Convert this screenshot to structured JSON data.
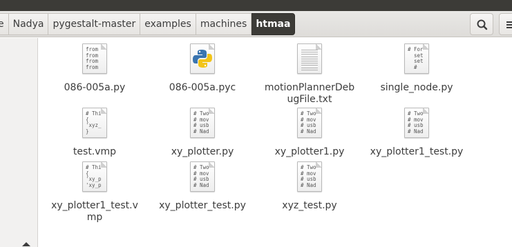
{
  "breadcrumb": {
    "items": [
      "e",
      "Nadya",
      "pygestalt-master",
      "examples",
      "machines"
    ],
    "current": "htmaa"
  },
  "header": {
    "search_icon": "search-icon",
    "menu_icon": "hamburger-menu-icon"
  },
  "sidebar": {
    "eject_icon": "eject-icon"
  },
  "files": [
    {
      "name": "086-005a.py",
      "kind": "text",
      "snippet": "from\nfrom\nfrom\nfrom"
    },
    {
      "name": "086-005a.pyc",
      "kind": "python"
    },
    {
      "name": "motionPlannerDebugFile.txt",
      "kind": "lines"
    },
    {
      "name": "single_node.py",
      "kind": "text",
      "snippet": "# For\n  set\n  set\n  #"
    },
    {
      "name": "test.vmp",
      "kind": "text",
      "snippet": "# Thi\n{\n'xyz_\n}"
    },
    {
      "name": "xy_plotter.py",
      "kind": "text",
      "snippet": "# Two\n# mov\n# usb\n# Nad"
    },
    {
      "name": "xy_plotter1.py",
      "kind": "text",
      "snippet": "# Two\n# mov\n# usb\n# Nad"
    },
    {
      "name": "xy_plotter1_test.py",
      "kind": "text",
      "snippet": "# Two\n# mov\n# usb\n# Nad"
    },
    {
      "name": "xy_plotter1_test.vmp",
      "kind": "text",
      "snippet": "# Thi\n{\n'xy_p\n'xy_p"
    },
    {
      "name": "xy_plotter_test.py",
      "kind": "text",
      "snippet": "# Two\n# mov\n# usb\n# Nad"
    },
    {
      "name": "xyz_test.py",
      "kind": "text",
      "snippet": "# Two\n# mov\n# usb\n# Nad"
    }
  ]
}
